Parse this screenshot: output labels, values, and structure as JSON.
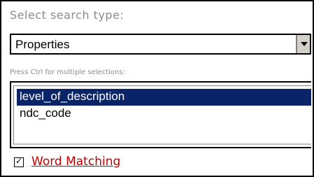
{
  "title": "Select search type:",
  "search_type_select": {
    "value": "Properties"
  },
  "hint": "Press Ctrl for multiple selections:",
  "properties_list": {
    "items": [
      {
        "label": "level_of_description",
        "selected": true
      },
      {
        "label": "ndc_code",
        "selected": false
      }
    ]
  },
  "word_matching": {
    "label": "Word Matching",
    "checked": true
  },
  "colors": {
    "selection_bg": "#0a246a",
    "link": "#c00000",
    "muted_text": "#8b8b8b"
  }
}
